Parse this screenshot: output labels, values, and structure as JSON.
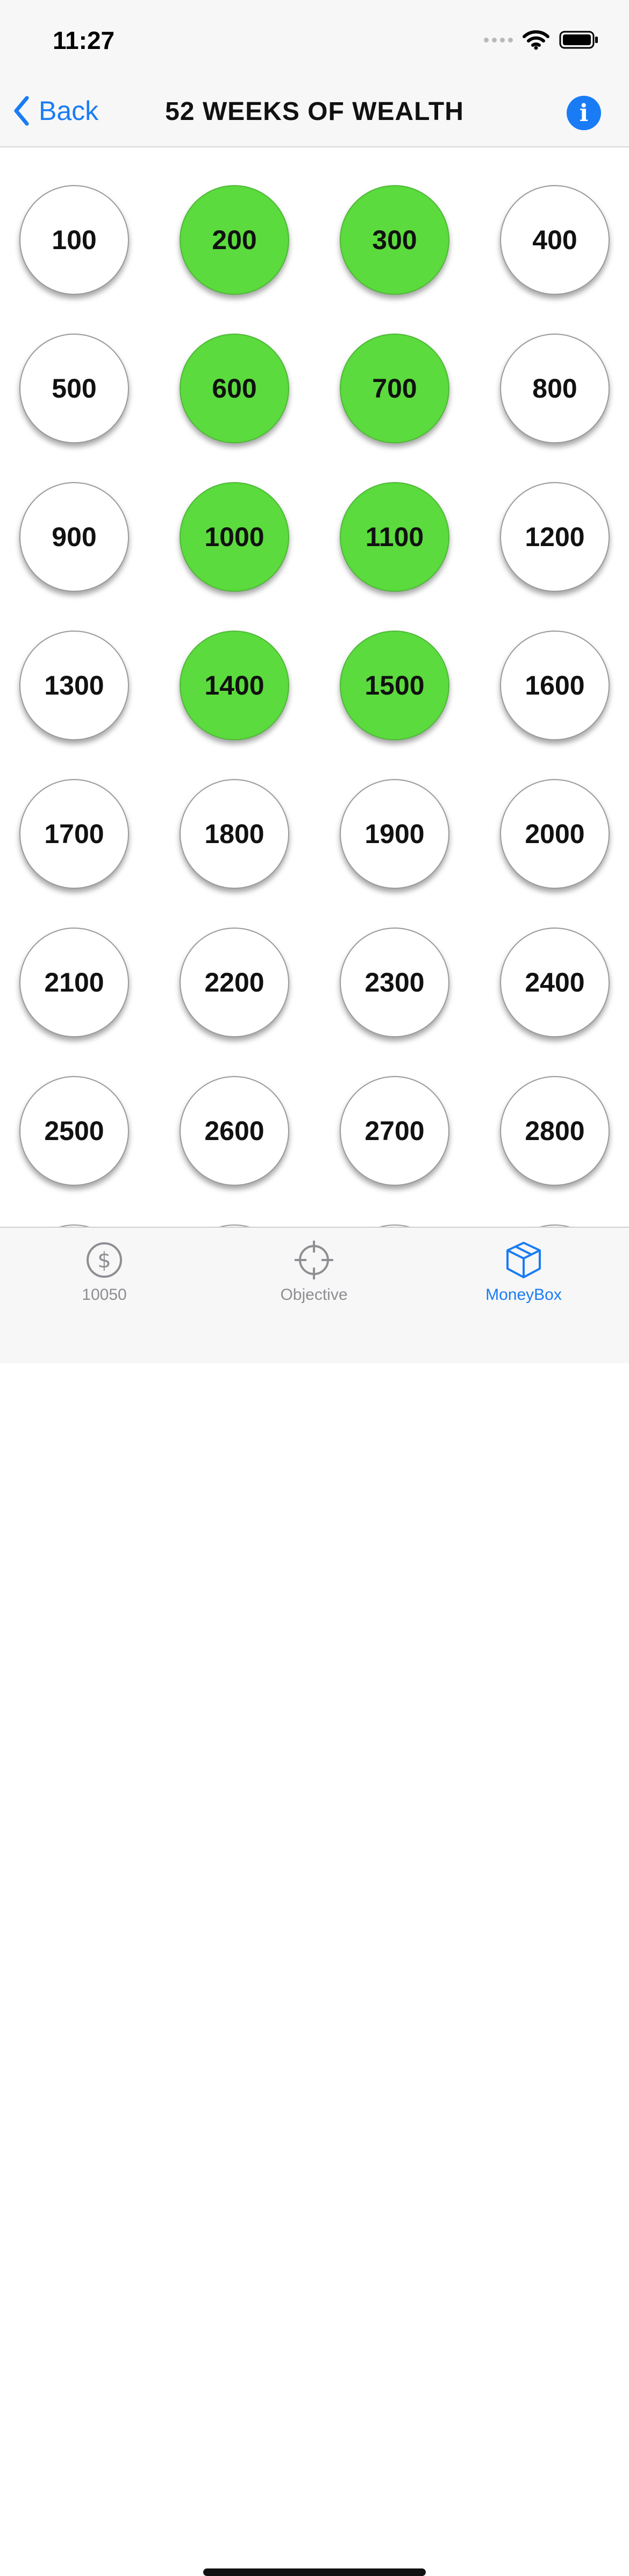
{
  "status_bar": {
    "time": "11:27"
  },
  "nav": {
    "back_label": "Back",
    "title": "52 WEEKS OF WEALTH",
    "info_icon": "info-icon"
  },
  "colors": {
    "accent": "#1a7cf5",
    "filled_coin": "#5bdb3d",
    "inactive_tab": "#8e8e93"
  },
  "coins": [
    {
      "label": "100",
      "filled": false
    },
    {
      "label": "200",
      "filled": true
    },
    {
      "label": "300",
      "filled": true
    },
    {
      "label": "400",
      "filled": false
    },
    {
      "label": "500",
      "filled": false
    },
    {
      "label": "600",
      "filled": true
    },
    {
      "label": "700",
      "filled": true
    },
    {
      "label": "800",
      "filled": false
    },
    {
      "label": "900",
      "filled": false
    },
    {
      "label": "1000",
      "filled": true
    },
    {
      "label": "1100",
      "filled": true
    },
    {
      "label": "1200",
      "filled": false
    },
    {
      "label": "1300",
      "filled": false
    },
    {
      "label": "1400",
      "filled": true
    },
    {
      "label": "1500",
      "filled": true
    },
    {
      "label": "1600",
      "filled": false
    },
    {
      "label": "1700",
      "filled": false
    },
    {
      "label": "1800",
      "filled": false
    },
    {
      "label": "1900",
      "filled": false
    },
    {
      "label": "2000",
      "filled": false
    },
    {
      "label": "2100",
      "filled": false
    },
    {
      "label": "2200",
      "filled": false
    },
    {
      "label": "2300",
      "filled": false
    },
    {
      "label": "2400",
      "filled": false
    },
    {
      "label": "2500",
      "filled": false
    },
    {
      "label": "2600",
      "filled": false
    },
    {
      "label": "2700",
      "filled": false
    },
    {
      "label": "2800",
      "filled": false
    },
    {
      "label": "",
      "filled": false
    },
    {
      "label": "",
      "filled": false
    },
    {
      "label": "",
      "filled": false
    },
    {
      "label": "",
      "filled": false
    }
  ],
  "tabs": [
    {
      "label": "10050",
      "icon": "dollar-circle-icon",
      "active": false
    },
    {
      "label": "Objective",
      "icon": "crosshair-icon",
      "active": false
    },
    {
      "label": "MoneyBox",
      "icon": "box-icon",
      "active": true
    }
  ]
}
